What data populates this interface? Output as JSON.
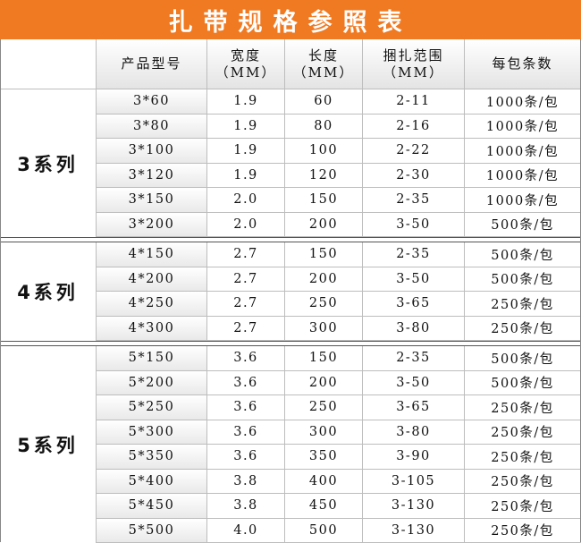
{
  "title": "扎带规格参照表",
  "headers": {
    "model": "产品型号",
    "width_name": "宽度",
    "width_unit": "（MM）",
    "length_name": "长度",
    "length_unit": "（MM）",
    "bundle_name": "捆扎范围",
    "bundle_unit": "（MM）",
    "pack": "每包条数"
  },
  "series": [
    {
      "label": "3系列",
      "rows": [
        {
          "model": "3*60",
          "width": "1.9",
          "length": "60",
          "range": "2-11",
          "pack": "1000条/包"
        },
        {
          "model": "3*80",
          "width": "1.9",
          "length": "80",
          "range": "2-16",
          "pack": "1000条/包"
        },
        {
          "model": "3*100",
          "width": "1.9",
          "length": "100",
          "range": "2-22",
          "pack": "1000条/包"
        },
        {
          "model": "3*120",
          "width": "1.9",
          "length": "120",
          "range": "2-30",
          "pack": "1000条/包"
        },
        {
          "model": "3*150",
          "width": "2.0",
          "length": "150",
          "range": "2-35",
          "pack": "1000条/包"
        },
        {
          "model": "3*200",
          "width": "2.0",
          "length": "200",
          "range": "3-50",
          "pack": "500条/包"
        }
      ]
    },
    {
      "label": "4系列",
      "rows": [
        {
          "model": "4*150",
          "width": "2.7",
          "length": "150",
          "range": "2-35",
          "pack": "500条/包"
        },
        {
          "model": "4*200",
          "width": "2.7",
          "length": "200",
          "range": "3-50",
          "pack": "500条/包"
        },
        {
          "model": "4*250",
          "width": "2.7",
          "length": "250",
          "range": "3-65",
          "pack": "250条/包"
        },
        {
          "model": "4*300",
          "width": "2.7",
          "length": "300",
          "range": "3-80",
          "pack": "250条/包"
        }
      ]
    },
    {
      "label": "5系列",
      "rows": [
        {
          "model": "5*150",
          "width": "3.6",
          "length": "150",
          "range": "2-35",
          "pack": "500条/包"
        },
        {
          "model": "5*200",
          "width": "3.6",
          "length": "200",
          "range": "3-50",
          "pack": "500条/包"
        },
        {
          "model": "5*250",
          "width": "3.6",
          "length": "250",
          "range": "3-65",
          "pack": "250条/包"
        },
        {
          "model": "5*300",
          "width": "3.6",
          "length": "300",
          "range": "3-80",
          "pack": "250条/包"
        },
        {
          "model": "5*350",
          "width": "3.6",
          "length": "350",
          "range": "3-90",
          "pack": "250条/包"
        },
        {
          "model": "5*400",
          "width": "3.8",
          "length": "400",
          "range": "3-105",
          "pack": "250条/包"
        },
        {
          "model": "5*450",
          "width": "3.8",
          "length": "450",
          "range": "3-130",
          "pack": "250条/包"
        },
        {
          "model": "5*500",
          "width": "4.0",
          "length": "500",
          "range": "3-130",
          "pack": "250条/包"
        }
      ]
    }
  ]
}
